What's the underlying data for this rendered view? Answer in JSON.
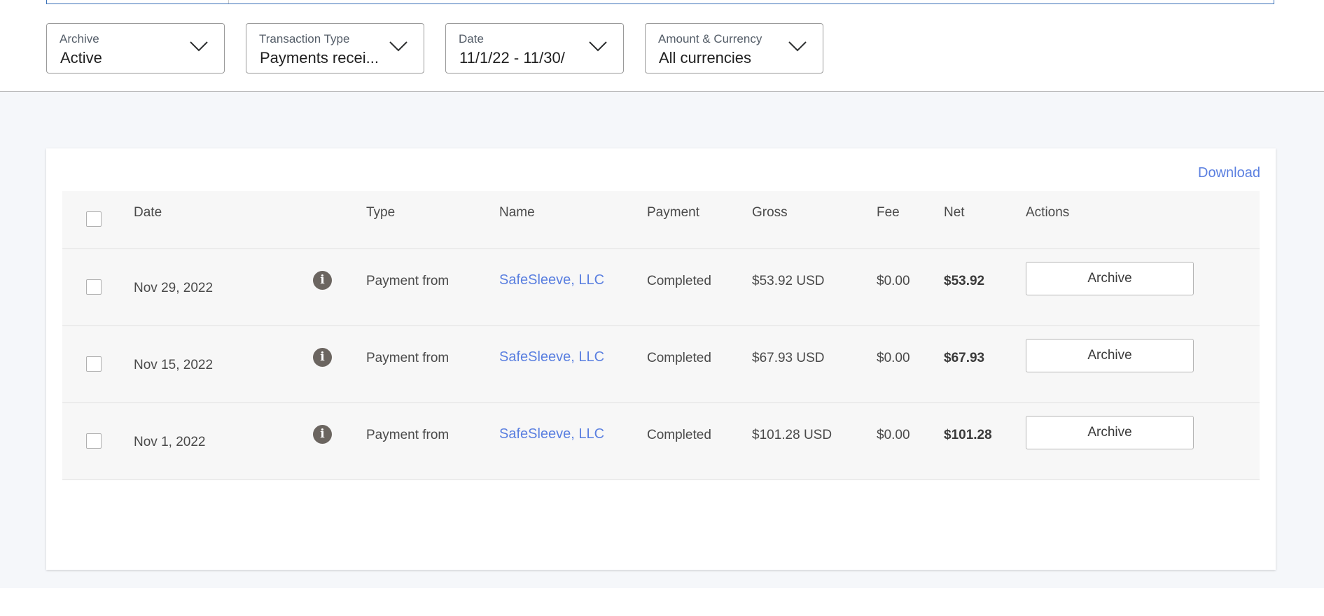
{
  "filters": [
    {
      "label": "Archive",
      "value": "Active"
    },
    {
      "label": "Transaction Type",
      "value": "Payments recei..."
    },
    {
      "label": "Date",
      "value": "11/1/22 - 11/30/"
    },
    {
      "label": "Amount & Currency",
      "value": "All currencies"
    }
  ],
  "download_label": "Download",
  "table": {
    "headers": {
      "date": "Date",
      "type": "Type",
      "name": "Name",
      "payment": "Payment",
      "gross": "Gross",
      "fee": "Fee",
      "net": "Net",
      "actions": "Actions"
    },
    "rows": [
      {
        "date": "Nov 29, 2022",
        "type": "Payment from",
        "name": "SafeSleeve, LLC",
        "payment": "Completed",
        "gross": "$53.92 USD",
        "fee": "$0.00",
        "net": "$53.92",
        "action": "Archive"
      },
      {
        "date": "Nov 15, 2022",
        "type": "Payment from",
        "name": "SafeSleeve, LLC",
        "payment": "Completed",
        "gross": "$67.93 USD",
        "fee": "$0.00",
        "net": "$67.93",
        "action": "Archive"
      },
      {
        "date": "Nov 1, 2022",
        "type": "Payment from",
        "name": "SafeSleeve, LLC",
        "payment": "Completed",
        "gross": "$101.28 USD",
        "fee": "$0.00",
        "net": "$101.28",
        "action": "Archive"
      }
    ]
  },
  "icons": {
    "info": "info-icon",
    "chevron": "chevron-down-icon"
  },
  "colors": {
    "link": "#5a7fe0",
    "border_accent": "#3b71b8"
  }
}
